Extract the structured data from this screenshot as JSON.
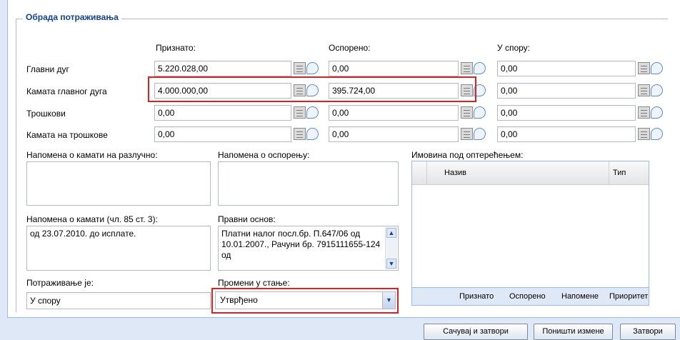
{
  "section_title": "Обрада потраживања",
  "columns": {
    "priznato": "Признато:",
    "osporeno": "Оспорено:",
    "u_sporu": "У спору:"
  },
  "rows": [
    {
      "label": "Главни дуг",
      "priznato": "5.220.028,00",
      "osporeno": "0,00",
      "u_sporu": "0,00"
    },
    {
      "label": "Камата главног дуга",
      "priznato": "4.000.000,00",
      "osporeno": "395.724,00",
      "u_sporu": "0,00"
    },
    {
      "label": "Трошкови",
      "priznato": "0,00",
      "osporeno": "0,00",
      "u_sporu": "0,00"
    },
    {
      "label": "Камата на трошкове",
      "priznato": "0,00",
      "osporeno": "0,00",
      "u_sporu": "0,00"
    }
  ],
  "notes": {
    "kamata_razlucno_label": "Напомена о камати на разлучно:",
    "kamata_razlucno_value": "",
    "osporenje_label": "Напомена о оспорењу:",
    "osporenje_value": "",
    "kamata_cl85_label": "Напомена о камати (чл. 85 ст. 3):",
    "kamata_cl85_value": "од 23.07.2010. до исплате.",
    "pravni_osnov_label": "Правни основ:",
    "pravni_osnov_value": "Платни налог посл.бр. П.647/06 од 10.01.2007., Рачуни бр. 7915111655-124 од"
  },
  "imovina": {
    "label": "Имовина под оптерећењем:",
    "col_naziv": "Назив",
    "col_tip": "Тип",
    "footer": [
      "Признато",
      "Оспорено",
      "Напомене",
      "Приоритет"
    ]
  },
  "status": {
    "label": "Потраживање је:",
    "value": "У спору",
    "change_label": "Промени у стање:",
    "change_value": "Утврђено"
  },
  "buttons": {
    "save_close": "Сачувај и затвори",
    "undo": "Поништи измене",
    "close": "Затвори"
  }
}
